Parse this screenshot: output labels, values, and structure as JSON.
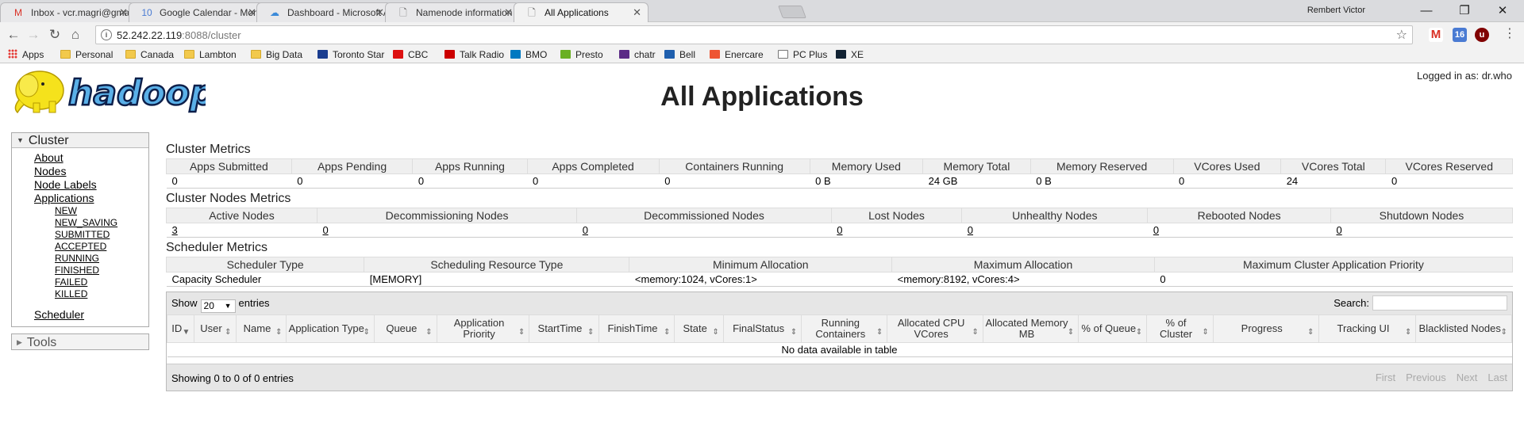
{
  "browser": {
    "tabs": [
      {
        "title": "Inbox - vcr.magri@gmai",
        "favicon": "M",
        "favicon_color": "#d93025",
        "active": false
      },
      {
        "title": "Google Calendar - Mont",
        "favicon": "10",
        "favicon_color": "#4a7bd3",
        "active": false
      },
      {
        "title": "Dashboard - Microsoft A",
        "favicon": "☁",
        "favicon_color": "#3b8ad9",
        "active": false
      },
      {
        "title": "Namenode information",
        "favicon": "🗋",
        "favicon_color": "#666666",
        "active": false
      },
      {
        "title": "All Applications",
        "favicon": "🗋",
        "favicon_color": "#666666",
        "active": true
      }
    ],
    "profile_name": "Rembert Victor",
    "url_host": "52.242.22.119",
    "url_rest": ":8088/cluster",
    "bookmarks": [
      {
        "label": "Apps",
        "icon": "apps-grid-icon"
      },
      {
        "label": "Personal",
        "icon": "folder-icon"
      },
      {
        "label": "Canada",
        "icon": "folder-icon"
      },
      {
        "label": "Lambton",
        "icon": "folder-icon"
      },
      {
        "label": "Big Data",
        "icon": "folder-icon"
      },
      {
        "label": "Toronto Star",
        "icon": "toronto-star-icon"
      },
      {
        "label": "CBC",
        "icon": "cbc-icon"
      },
      {
        "label": "Talk Radio",
        "icon": "talk-radio-icon"
      },
      {
        "label": "BMO",
        "icon": "bmo-icon"
      },
      {
        "label": "Presto",
        "icon": "presto-icon"
      },
      {
        "label": "chatr",
        "icon": "chatr-icon"
      },
      {
        "label": "Bell",
        "icon": "bell-icon"
      },
      {
        "label": "Enercare",
        "icon": "enercare-icon"
      },
      {
        "label": "PC Plus",
        "icon": "page-icon"
      },
      {
        "label": "XE",
        "icon": "xe-icon"
      }
    ]
  },
  "page": {
    "title": "All Applications",
    "logged_in": "Logged in as: dr.who",
    "logo_text": "hadoop"
  },
  "nav": {
    "cluster_label": "Cluster",
    "links": [
      "About",
      "Nodes",
      "Node Labels",
      "Applications"
    ],
    "app_states": [
      "NEW",
      "NEW_SAVING",
      "SUBMITTED",
      "ACCEPTED",
      "RUNNING",
      "FINISHED",
      "FAILED",
      "KILLED"
    ],
    "scheduler": "Scheduler",
    "tools_label": "Tools"
  },
  "cluster_metrics": {
    "title": "Cluster Metrics",
    "headers": [
      "Apps Submitted",
      "Apps Pending",
      "Apps Running",
      "Apps Completed",
      "Containers Running",
      "Memory Used",
      "Memory Total",
      "Memory Reserved",
      "VCores Used",
      "VCores Total",
      "VCores Reserved"
    ],
    "values": [
      "0",
      "0",
      "0",
      "0",
      "0",
      "0 B",
      "24 GB",
      "0 B",
      "0",
      "24",
      "0"
    ]
  },
  "node_metrics": {
    "title": "Cluster Nodes Metrics",
    "headers": [
      "Active Nodes",
      "Decommissioning Nodes",
      "Decommissioned Nodes",
      "Lost Nodes",
      "Unhealthy Nodes",
      "Rebooted Nodes",
      "Shutdown Nodes"
    ],
    "values": [
      "3",
      "0",
      "0",
      "0",
      "0",
      "0",
      "0"
    ]
  },
  "scheduler_metrics": {
    "title": "Scheduler Metrics",
    "headers": [
      "Scheduler Type",
      "Scheduling Resource Type",
      "Minimum Allocation",
      "Maximum Allocation",
      "Maximum Cluster Application Priority"
    ],
    "values": [
      "Capacity Scheduler",
      "[MEMORY]",
      "<memory:1024, vCores:1>",
      "<memory:8192, vCores:4>",
      "0"
    ]
  },
  "apps_table": {
    "show_label": "Show",
    "entries_value": "20",
    "entries_label": "entries",
    "search_label": "Search:",
    "search_value": "",
    "columns": [
      "ID",
      "User",
      "Name",
      "Application Type",
      "Queue",
      "Application Priority",
      "StartTime",
      "FinishTime",
      "State",
      "FinalStatus",
      "Running Containers",
      "Allocated CPU VCores",
      "Allocated Memory MB",
      "% of Queue",
      "% of Cluster",
      "Progress",
      "Tracking UI",
      "Blacklisted Nodes"
    ],
    "empty_message": "No data available in table",
    "info": "Showing 0 to 0 of 0 entries",
    "pager": [
      "First",
      "Previous",
      "Next",
      "Last"
    ]
  }
}
